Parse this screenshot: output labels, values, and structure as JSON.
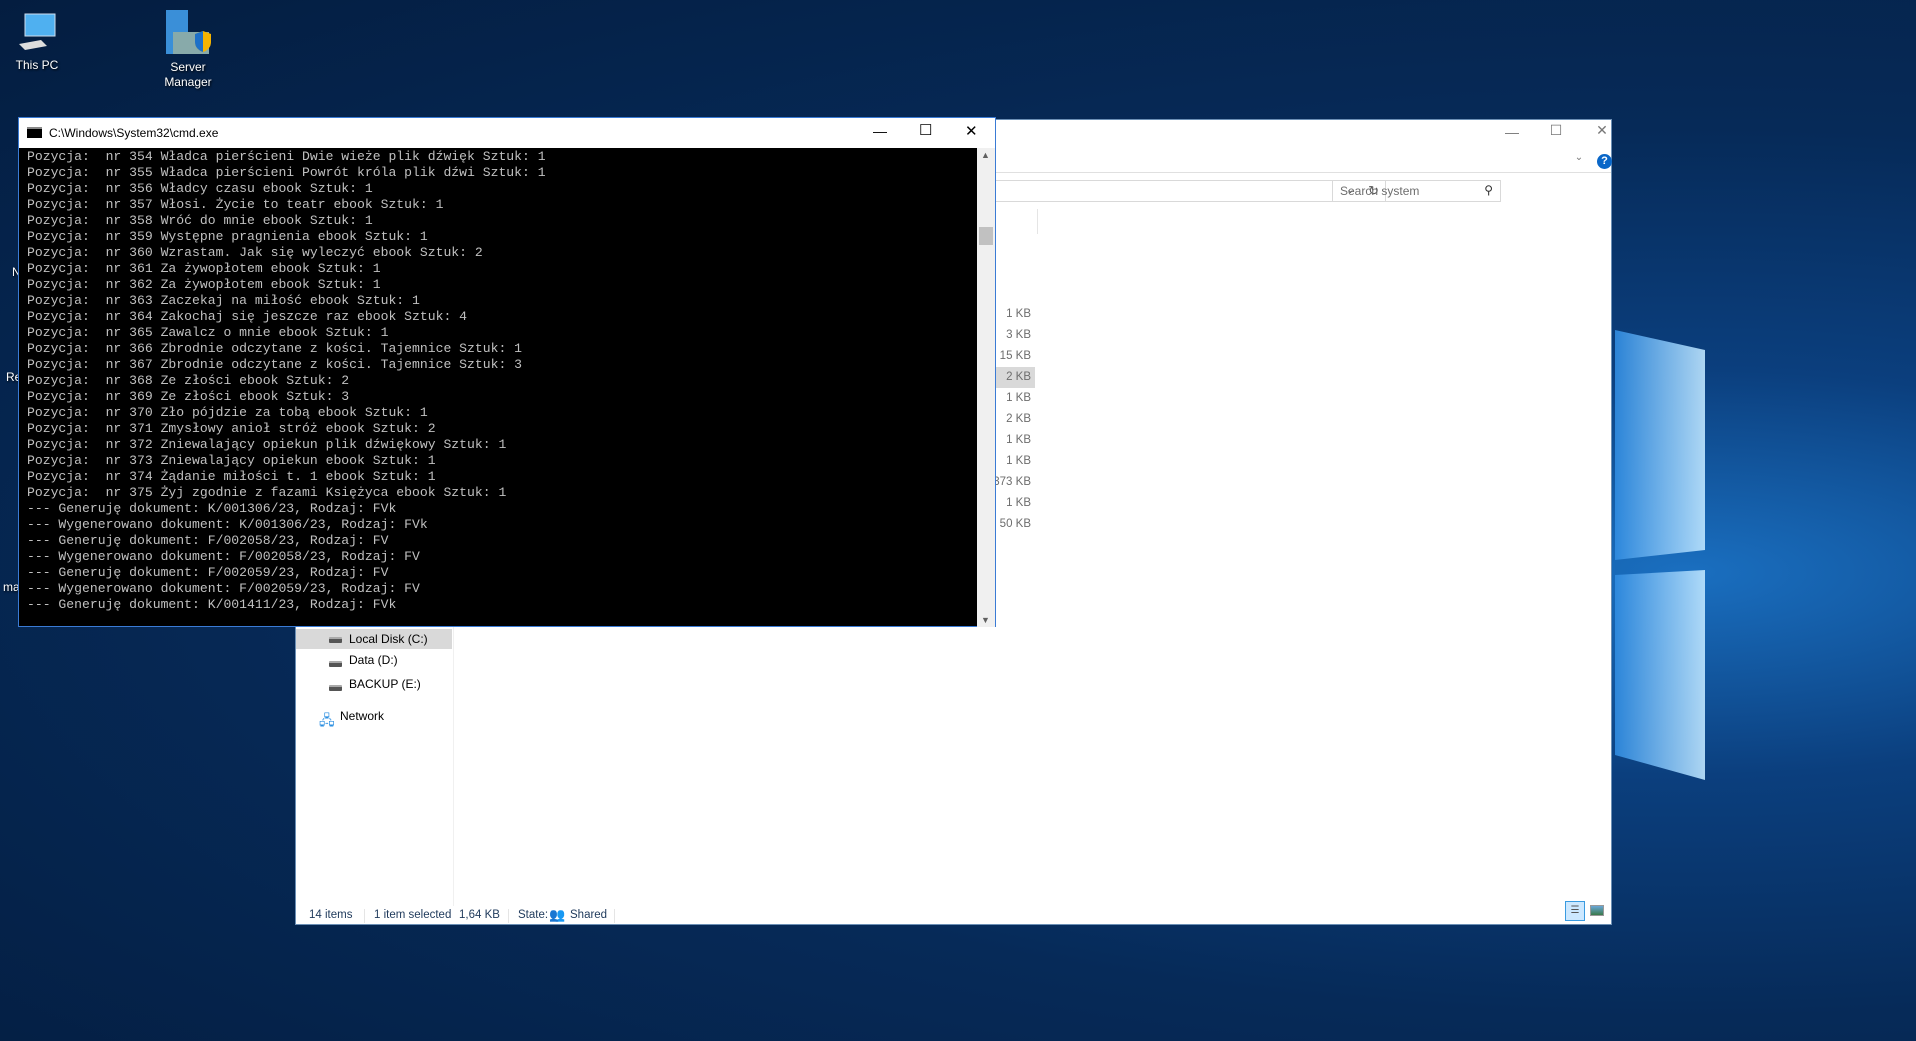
{
  "desktop": {
    "icons": [
      {
        "label": "This PC"
      },
      {
        "label": "Server Manager"
      }
    ],
    "partial_labels": [
      "N",
      "Re",
      "ma"
    ]
  },
  "cmd": {
    "title": "C:\\Windows\\System32\\cmd.exe",
    "lines": [
      "Pozycja:  nr 354 Władca pierścieni Dwie wieże plik dźwięk Sztuk: 1",
      "Pozycja:  nr 355 Władca pierścieni Powrót króla plik dźwi Sztuk: 1",
      "Pozycja:  nr 356 Władcy czasu ebook Sztuk: 1",
      "Pozycja:  nr 357 Włosi. Życie to teatr ebook Sztuk: 1",
      "Pozycja:  nr 358 Wróć do mnie ebook Sztuk: 1",
      "Pozycja:  nr 359 Występne pragnienia ebook Sztuk: 1",
      "Pozycja:  nr 360 Wzrastam. Jak się wyleczyć ebook Sztuk: 2",
      "Pozycja:  nr 361 Za żywopłotem ebook Sztuk: 1",
      "Pozycja:  nr 362 Za żywopłotem ebook Sztuk: 1",
      "Pozycja:  nr 363 Zaczekaj na miłość ebook Sztuk: 1",
      "Pozycja:  nr 364 Zakochaj się jeszcze raz ebook Sztuk: 4",
      "Pozycja:  nr 365 Zawalcz o mnie ebook Sztuk: 1",
      "Pozycja:  nr 366 Zbrodnie odczytane z kości. Tajemnice Sztuk: 1",
      "Pozycja:  nr 367 Zbrodnie odczytane z kości. Tajemnice Sztuk: 3",
      "Pozycja:  nr 368 Ze złości ebook Sztuk: 2",
      "Pozycja:  nr 369 Ze złości ebook Sztuk: 3",
      "Pozycja:  nr 370 Zło pójdzie za tobą ebook Sztuk: 1",
      "Pozycja:  nr 371 Zmysłowy anioł stróż ebook Sztuk: 2",
      "Pozycja:  nr 372 Zniewalający opiekun plik dźwiękowy Sztuk: 1",
      "Pozycja:  nr 373 Zniewalający opiekun ebook Sztuk: 1",
      "Pozycja:  nr 374 Żądanie miłości t. 1 ebook Sztuk: 1",
      "Pozycja:  nr 375 Żyj zgodnie z fazami Księżyca ebook Sztuk: 1",
      "--- Generuję dokument: K/001306/23, Rodzaj: FVk",
      "--- Wygenerowano dokument: K/001306/23, Rodzaj: FVk",
      "--- Generuję dokument: F/002058/23, Rodzaj: FV",
      "--- Wygenerowano dokument: F/002058/23, Rodzaj: FV",
      "--- Generuję dokument: F/002059/23, Rodzaj: FV",
      "--- Wygenerowano dokument: F/002059/23, Rodzaj: FV",
      "--- Generuję dokument: K/001411/23, Rodzaj: FVk"
    ]
  },
  "explorer": {
    "search_placeholder": "Search system",
    "sizes": [
      "1 KB",
      "3 KB",
      "15 KB",
      "2 KB",
      "1 KB",
      "2 KB",
      "1 KB",
      "1 KB",
      "373 KB",
      "1 KB",
      "50 KB"
    ],
    "selected_index": 3,
    "nav": {
      "local_disk": "Local Disk (C:)",
      "data": "Data (D:)",
      "backup": "BACKUP (E:)",
      "network": "Network"
    },
    "status": {
      "items": "14 items",
      "selected": "1 item selected",
      "size": "1,64 KB",
      "state_label": "State:",
      "state": "Shared"
    }
  },
  "colors": {
    "accent": "#0078d7",
    "console_bg": "#000000",
    "console_fg": "#c0c0c0"
  }
}
